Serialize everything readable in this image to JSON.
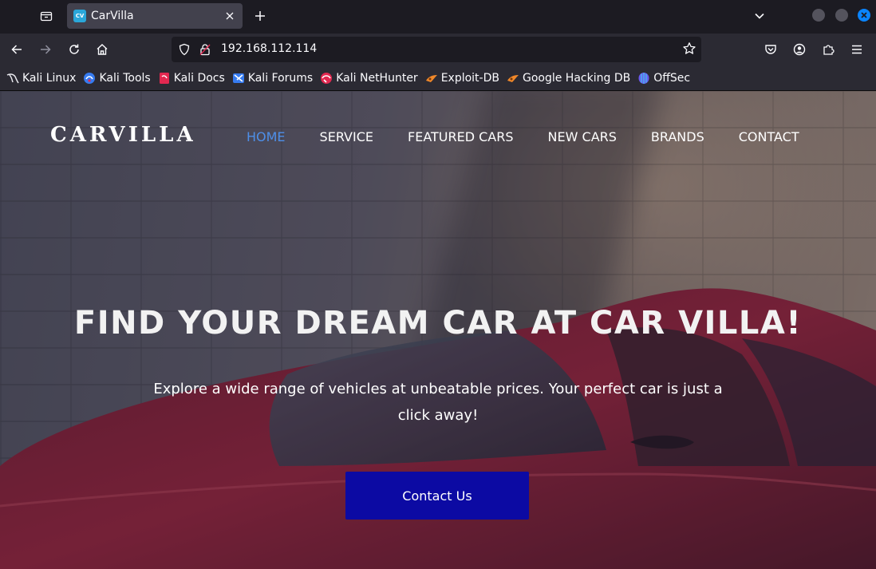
{
  "browser": {
    "tab": {
      "title": "CarVilla",
      "favicon_text": "CV"
    },
    "url": "192.168.112.114",
    "bookmarks": [
      {
        "label": "Kali Linux",
        "icon": "kali-dragon-icon"
      },
      {
        "label": "Kali Tools",
        "icon": "kali-tools-icon"
      },
      {
        "label": "Kali Docs",
        "icon": "kali-docs-icon"
      },
      {
        "label": "Kali Forums",
        "icon": "kali-forums-icon"
      },
      {
        "label": "Kali NetHunter",
        "icon": "kali-nethunter-icon"
      },
      {
        "label": "Exploit-DB",
        "icon": "exploit-db-icon"
      },
      {
        "label": "Google Hacking DB",
        "icon": "ghdb-icon"
      },
      {
        "label": "OffSec",
        "icon": "offsec-icon"
      }
    ],
    "colors": {
      "accent": "#0a84ff",
      "tab_bg": "#42414d",
      "toolbar_bg": "#2b2a33"
    }
  },
  "site": {
    "logo": "CARVILLA",
    "menu": [
      {
        "label": "HOME",
        "active": true
      },
      {
        "label": "SERVICE",
        "active": false
      },
      {
        "label": "FEATURED CARS",
        "active": false
      },
      {
        "label": "NEW CARS",
        "active": false
      },
      {
        "label": "BRANDS",
        "active": false
      },
      {
        "label": "CONTACT",
        "active": false
      }
    ],
    "hero": {
      "title": "FIND YOUR DREAM CAR AT CAR VILLA!",
      "subtitle": "Explore a wide range of vehicles at unbeatable prices. Your perfect car is just a click away!",
      "cta_label": "Contact Us"
    },
    "colors": {
      "active_menu": "#4e8fe8",
      "cta_bg": "#0c0aa3",
      "car": "#9e2a3c"
    }
  }
}
